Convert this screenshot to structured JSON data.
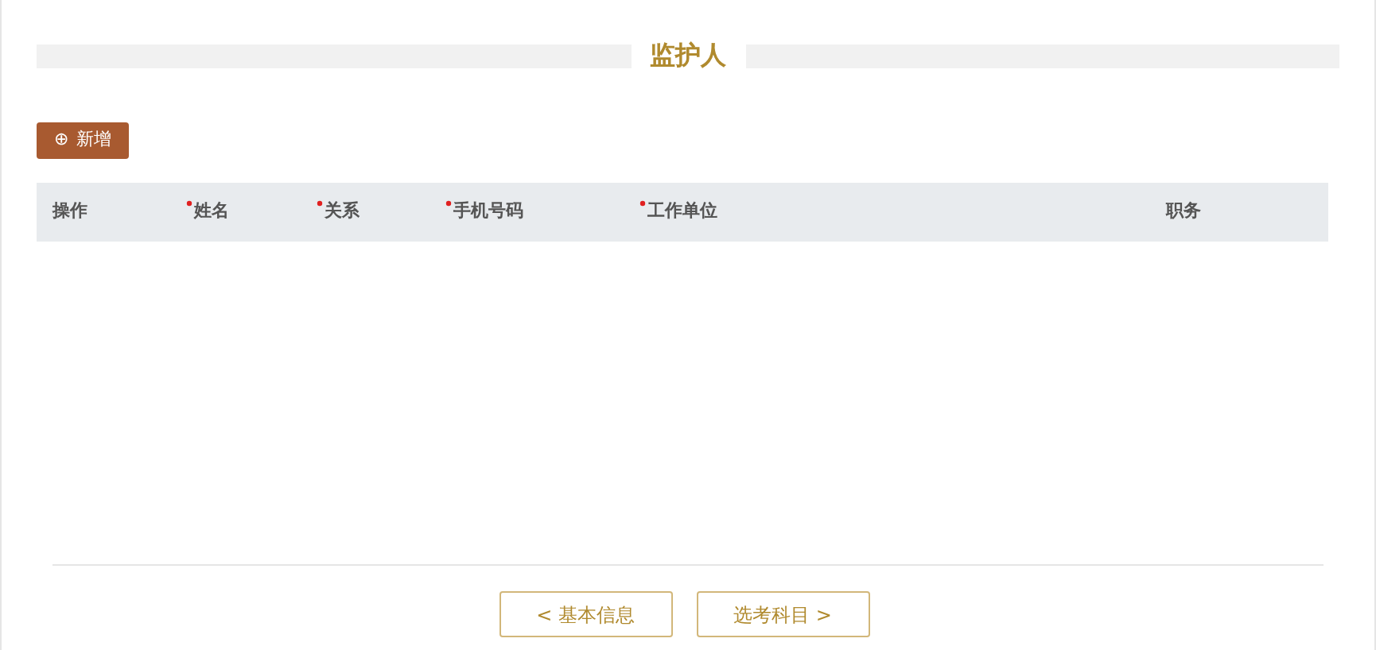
{
  "section_title": "监护人",
  "add_button": {
    "icon": "⊕",
    "label": "新增"
  },
  "table": {
    "columns": [
      {
        "label": "操作",
        "required": false
      },
      {
        "label": "姓名",
        "required": true
      },
      {
        "label": "关系",
        "required": true
      },
      {
        "label": "手机号码",
        "required": true
      },
      {
        "label": "工作单位",
        "required": true
      },
      {
        "label": "职务",
        "required": false
      }
    ]
  },
  "nav_buttons": [
    "< 基本信息",
    "选考科目 >"
  ]
}
